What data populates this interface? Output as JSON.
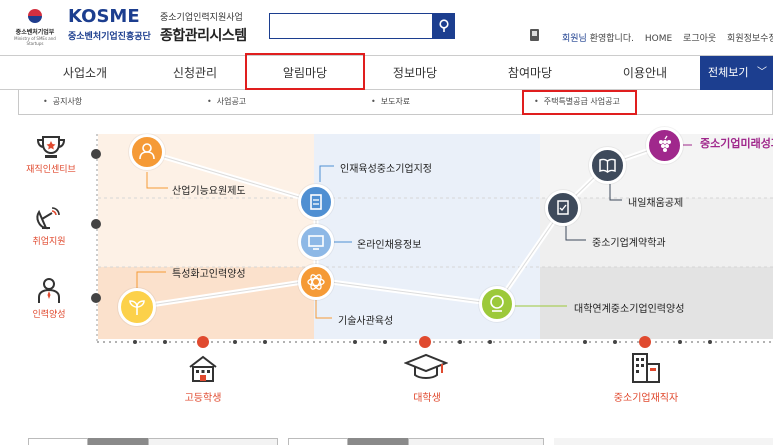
{
  "header": {
    "ministry_name": "중소벤처기업부",
    "ministry_sub": "Ministry of SMEs and Startups",
    "logo_text": "KOSME",
    "agency_name": "중소벤처기업진흥공단",
    "system_sub": "중소기업인력지원사업",
    "system_title": "종합관리시스템",
    "search_placeholder": "",
    "search_icon": "search-icon",
    "user_name": "회원님",
    "welcome": "환영합니다.",
    "util_links": [
      "HOME",
      "로그아웃",
      "회원정보수정"
    ]
  },
  "gnb": {
    "items": [
      "사업소개",
      "신청관리",
      "알림마당",
      "정보마당",
      "참여마당",
      "이용안내"
    ],
    "all_label": "전체보기",
    "highlighted": "알림마당"
  },
  "submenu": {
    "items": [
      "공지사항",
      "사업공고",
      "보도자료",
      "주택특별공급 사업공고"
    ],
    "highlighted": "주택특별공급 사업공고"
  },
  "diagram": {
    "categories": [
      "재직인센티브",
      "취업지원",
      "인력양성"
    ],
    "programs": {
      "p1": "산업기능요원제도",
      "p2": "인재육성중소기업지정",
      "p3": "온라인채용정보",
      "p4": "특성화고인력양성",
      "p5": "기술사관육성",
      "p6": "중소기업미래성과공유제",
      "p7": "내일채움공제",
      "p8": "중소기업계약학과",
      "p9": "대학연계중소기업인력양성"
    },
    "stages": [
      "고등학생",
      "대학생",
      "중소기업재직자"
    ],
    "colors": {
      "orange": "#f59a36",
      "blue": "#4f8fd2",
      "green": "#9cc93a",
      "navy": "#3e4a5b",
      "purple": "#a0288c",
      "accent_red": "#e04a2f",
      "brand": "#1c3e8f"
    }
  }
}
